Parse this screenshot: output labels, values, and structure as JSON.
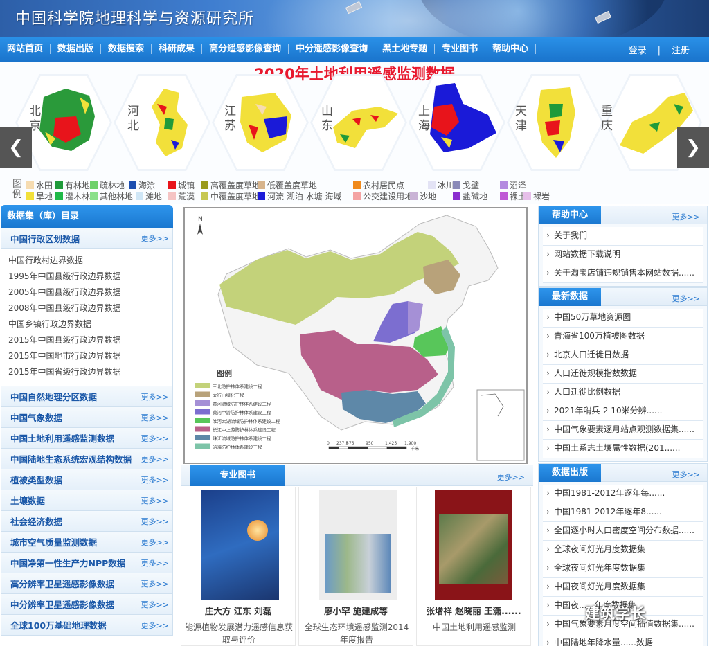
{
  "site": {
    "title": "中国科学院地理科学与资源研究所"
  },
  "nav": {
    "items": [
      "网站首页",
      "数据出版",
      "数据搜索",
      "科研成果",
      "高分遥感影像查询",
      "中分遥感影像查询",
      "黑土地专题",
      "专业图书",
      "帮助中心"
    ],
    "login": "登录",
    "divider": "|",
    "register": "注册"
  },
  "slider": {
    "title": "2020年土地利用遥感监测数据",
    "provinces": [
      "北京",
      "河北",
      "江苏",
      "山东",
      "上海",
      "天津",
      "重庆"
    ],
    "prev": "❮",
    "next": "❯",
    "legend_title": "图例",
    "legend": [
      {
        "label": "水田",
        "color": "#f6dcb1"
      },
      {
        "label": "有林地",
        "color": "#1f9a3a"
      },
      {
        "label": "疏林地",
        "color": "#6fd16b"
      },
      {
        "label": "海涂",
        "color": "#1c4eb0"
      },
      {
        "label": "城镇",
        "color": "#e8141b"
      },
      {
        "label": "高覆盖度草地",
        "color": "#9a9a1d"
      },
      {
        "label": "低覆盖度草地",
        "color": "#d7b48c"
      },
      {
        "label": "农村居民点",
        "color": "#f08a1c"
      },
      {
        "label": "冰川",
        "color": "#e3e3f5"
      },
      {
        "label": "戈壁",
        "color": "#8a8ab8"
      },
      {
        "label": "沼泽",
        "color": "#b48ae0"
      },
      {
        "label": "旱地",
        "color": "#f2e03a"
      },
      {
        "label": "灌木林",
        "color": "#1fb848"
      },
      {
        "label": "其他林地",
        "color": "#8ae08a"
      },
      {
        "label": "滩地",
        "color": "#cfe6f6"
      },
      {
        "label": "荒漠",
        "color": "#f5c4c4"
      },
      {
        "label": "中覆盖度草地",
        "color": "#c7c751"
      },
      {
        "label": "河流 湖泊 水塘 海域",
        "color": "#1a1ad8"
      },
      {
        "label": "公交建设用地",
        "color": "#f4a3a3"
      },
      {
        "label": "沙地",
        "color": "#c9b3d6"
      },
      {
        "label": "盐碱地",
        "color": "#8a2fcf"
      },
      {
        "label": "裸土",
        "color": "#c05ad6"
      },
      {
        "label": "裸岩",
        "color": "#e6bfe9"
      }
    ]
  },
  "catalog": {
    "header": "数据集（库）目录",
    "more": "更多>>",
    "first": {
      "title": "中国行政区划数据",
      "items": [
        "中国行政村边界数据",
        "1995年中国县级行政边界数据",
        "2005年中国县级行政边界数据",
        "2008年中国县级行政边界数据",
        "中国乡镇行政边界数据",
        "2015年中国县级行政边界数据",
        "2015年中国地市行政边界数据",
        "2015年中国省级行政边界数据"
      ]
    },
    "categories": [
      "中国自然地理分区数据",
      "中国气象数据",
      "中国土地利用遥感监测数据",
      "中国陆地生态系统宏观结构数据",
      "植被类型数据",
      "土壤数据",
      "社会经济数据",
      "城市空气质量监测数据",
      "中国净第一性生产力NPP数据",
      "高分辨率卫星遥感影像数据",
      "中分辨率卫星遥感影像数据",
      "全球100万基础地理数据"
    ]
  },
  "map": {
    "north": "N",
    "legend_title": "图例",
    "legend": [
      {
        "label": "三北防护林体系建设工程",
        "color": "#c3d27a"
      },
      {
        "label": "太行山绿化工程",
        "color": "#b8a27a"
      },
      {
        "label": "黄河流域防护林体系建设工程",
        "color": "#a590d6"
      },
      {
        "label": "黄河中游防护林体系建设工程",
        "color": "#7c6ed0"
      },
      {
        "label": "淮河太湖流域防护林体系建设工程",
        "color": "#58c65a"
      },
      {
        "label": "长江中上游防护林体系建设工程",
        "color": "#b8608a"
      },
      {
        "label": "珠江流域防护林体系建设工程",
        "color": "#5e88a8"
      },
      {
        "label": "沿海防护林体系建设工程",
        "color": "#7dc4a8"
      }
    ],
    "scale_labels": [
      "0",
      "237.5",
      "475",
      "950",
      "1,425",
      "1,900"
    ],
    "scale_unit": "千米"
  },
  "books": {
    "header": "专业图书",
    "more": "更多>>",
    "items": [
      {
        "author": "庄大方 江东 刘磊",
        "title": "能源植物发展潜力遥感信息获取与评价"
      },
      {
        "author": "廖小罕 施建成等",
        "title": "全球生态环境遥感监测2014年度报告"
      },
      {
        "author": "张增祥 赵晓丽 王潇......",
        "title": "中国土地利用遥感监测"
      }
    ]
  },
  "help": {
    "header": "帮助中心",
    "more": "更多>>",
    "items": [
      "关于我们",
      "网站数据下载说明",
      "关于淘宝店铺违规销售本网站数据......"
    ]
  },
  "latest": {
    "header": "最新数据",
    "more": "更多>>",
    "items": [
      "中国50万草地资源图",
      "青海省100万植被图数据",
      "北京人口迁徙日数据",
      "人口迁徙规模指数数据",
      "人口迁徙比例数据",
      "2021年哨兵-2 10米分辨......",
      "中国气象要素逐月站点观测数据集......",
      "中国土系志土壤属性数据(201......"
    ]
  },
  "publish": {
    "header": "数据出版",
    "more": "更多>>",
    "items": [
      "中国1981-2012年逐年每......",
      "中国1981-2012年逐年8......",
      "全国逐小时人口密度空间分布数据......",
      "全球夜间灯光月度数据集",
      "全球夜间灯光年度数据集",
      "中国夜间灯光月度数据集",
      "中国夜......年度数据集",
      "中国气象要素月度空间插值数据集......",
      "中国陆地年降水量......数据"
    ]
  },
  "watermark": "建筑学长"
}
